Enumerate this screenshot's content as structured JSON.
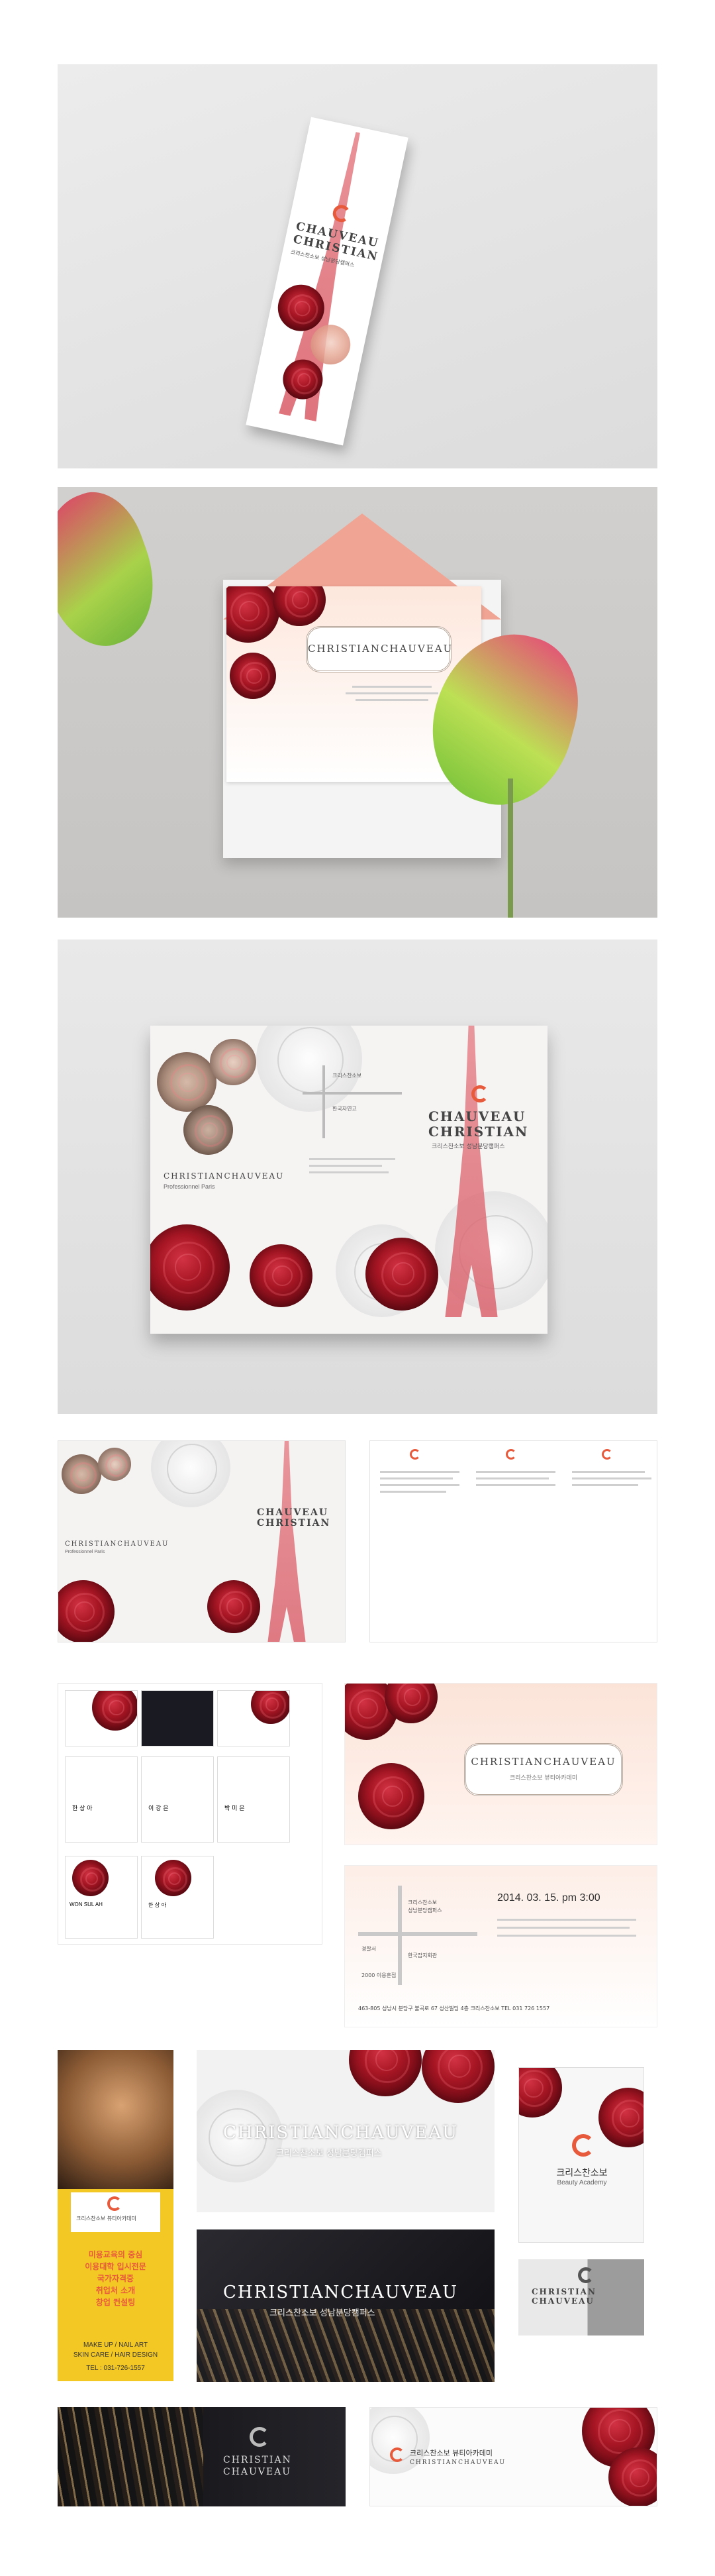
{
  "brand": {
    "name_stacked_1": "CHAUVEAU",
    "name_stacked_2": "CHRISTIAN",
    "name_inline": "ChristianChauveau",
    "name_inline_caps": "CHRISTIANCHAUVEAU",
    "ko_full": "크리스찬소보 성남분당캠퍼스",
    "ko_academy": "크리스찬소보 뷰티아카데미",
    "ko_short": "크리스찬소보",
    "professionnel": "Professionnel Paris",
    "beauty_academy": "Beauty Academy"
  },
  "invitation": {
    "date_time": "2014. 03. 15.  pm 3:00",
    "address": "463-805 성남시 분당구 불곡로 67 성산빌딩 4층 크리스찬소보 TEL 031 726 1557",
    "map_label_1": "크리스찬소보",
    "map_label_2": "성남분당캠퍼스",
    "map_label_3": "한국자연고",
    "map_label_4": "경찰서",
    "map_label_5": "한국잡지회관",
    "map_label_6": "2000 이용훈점"
  },
  "card_names": [
    "한 상 아",
    "이 강 은",
    "박 미 은",
    "WON SUL AH",
    "한 상 아"
  ],
  "banner": {
    "tagline_1": "미용교육의 중심",
    "tagline_2": "이용대학 입시전문",
    "tagline_3": "국가자격증",
    "tagline_4": "취업처 소개",
    "tagline_5": "창업 컨설팅",
    "services_1": "MAKE UP / NAIL ART",
    "services_2": "SKIN CARE / HAIR DESIGN",
    "tel": "TEL : 031-726-1557"
  },
  "colors": {
    "accent": "#e85a3c",
    "rose": "#a81624",
    "tower": "#d95b66",
    "banner_yellow": "#f3c824"
  }
}
